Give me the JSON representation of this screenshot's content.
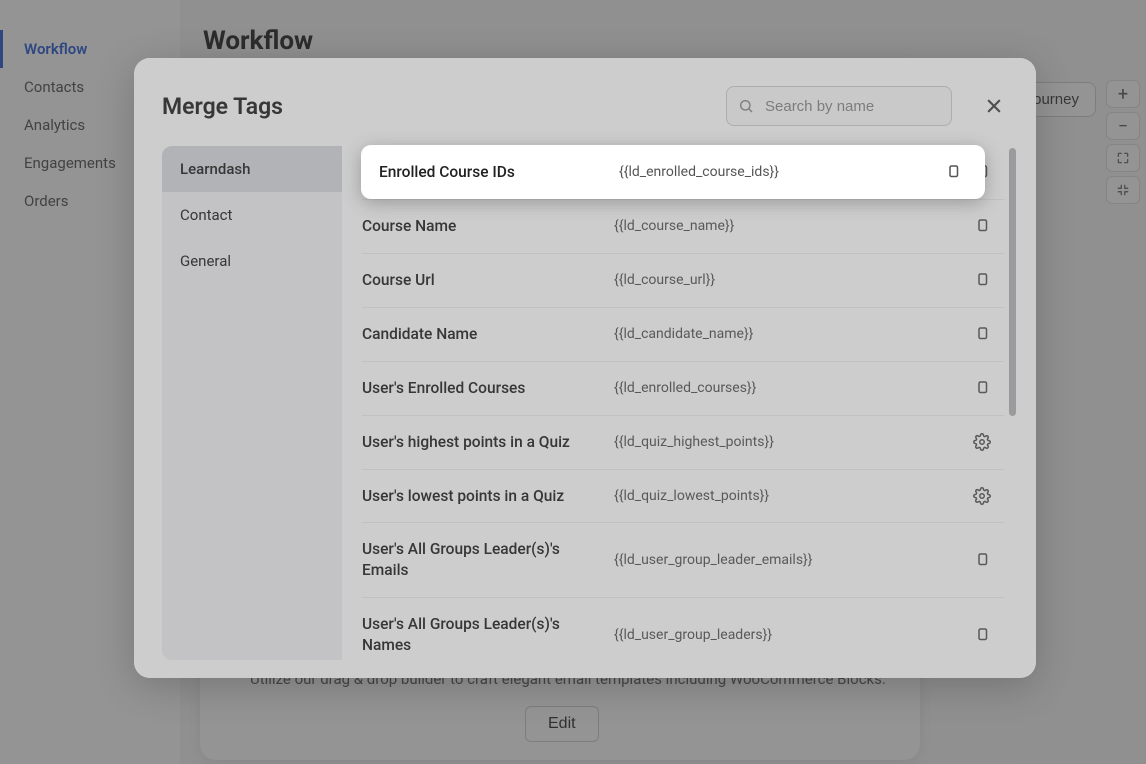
{
  "sidebar": {
    "items": [
      {
        "label": "Workflow",
        "active": true
      },
      {
        "label": "Contacts",
        "active": false
      },
      {
        "label": "Analytics",
        "active": false
      },
      {
        "label": "Engagements",
        "active": false
      },
      {
        "label": "Orders",
        "active": false
      }
    ]
  },
  "page": {
    "title": "Workflow",
    "top_button": "Journey",
    "description": "Utilize our drag & drop builder to craft elegant email templates including WooCommerce Blocks.",
    "edit_label": "Edit"
  },
  "modal": {
    "title": "Merge Tags",
    "search_placeholder": "Search by name",
    "categories": [
      {
        "label": "Learndash",
        "active": true
      },
      {
        "label": "Contact",
        "active": false
      },
      {
        "label": "General",
        "active": false
      }
    ],
    "highlighted": {
      "label": "Enrolled Course IDs",
      "code": "{{ld_enrolled_course_ids}}",
      "action": "copy"
    },
    "tags": [
      {
        "label": "Enrolled Course IDs",
        "code": "{{ld_enrolled_course_ids}}",
        "action": "copy"
      },
      {
        "label": "Course Name",
        "code": "{{ld_course_name}}",
        "action": "copy"
      },
      {
        "label": "Course Url",
        "code": "{{ld_course_url}}",
        "action": "copy"
      },
      {
        "label": "Candidate Name",
        "code": "{{ld_candidate_name}}",
        "action": "copy"
      },
      {
        "label": "User's Enrolled Courses",
        "code": "{{ld_enrolled_courses}}",
        "action": "copy"
      },
      {
        "label": "User's highest points in a Quiz",
        "code": "{{ld_quiz_highest_points}}",
        "action": "settings"
      },
      {
        "label": "User's lowest points in a Quiz",
        "code": "{{ld_quiz_lowest_points}}",
        "action": "settings"
      },
      {
        "label": "User's All Groups Leader(s)'s Emails",
        "code": "{{ld_user_group_leader_emails}}",
        "action": "copy"
      },
      {
        "label": "User's All Groups Leader(s)'s Names",
        "code": "{{ld_user_group_leaders}}",
        "action": "copy"
      }
    ]
  }
}
